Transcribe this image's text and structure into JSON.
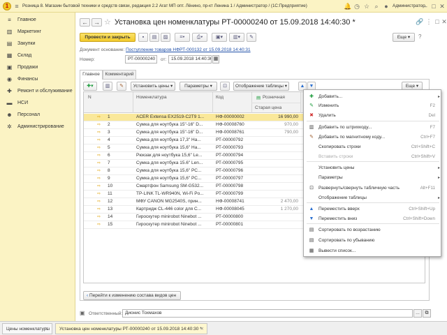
{
  "window": {
    "title": "Розница 8. Магазин бытовой техники и средств связи, редакция 2.2 Агат МП опт. Лёнино, пр-кт Ленина 1 / Администратор / (1С:Предприятие)",
    "user": "Администратор"
  },
  "sidebar": {
    "items": [
      {
        "label": "Главное",
        "icon": "menu-icon"
      },
      {
        "label": "Маркетинг",
        "icon": "chart-icon"
      },
      {
        "label": "Закупки",
        "icon": "basket-icon"
      },
      {
        "label": "Склад",
        "icon": "warehouse-icon"
      },
      {
        "label": "Продажи",
        "icon": "sales-icon"
      },
      {
        "label": "Финансы",
        "icon": "finance-icon"
      },
      {
        "label": "Ремонт и обслуживание",
        "icon": "repair-icon"
      },
      {
        "label": "НСИ",
        "icon": "book-icon"
      },
      {
        "label": "Персонал",
        "icon": "person-icon"
      },
      {
        "label": "Администрирование",
        "icon": "gear-icon"
      }
    ]
  },
  "document": {
    "title": "Установка цен номенклатуры РТ-00000240 от 15.09.2018 14:40:30 *",
    "post_close_label": "Провести и закрыть",
    "more_label": "Еще",
    "basis_label": "Документ основание:",
    "basis_link": "Поступление товаров НФРТ-000132 от 15.09.2018 14:40:31",
    "number_label": "Номер:",
    "number_value": "РТ-00000240",
    "date_label": "от:",
    "date_value": "15.09.2018 14:40:30",
    "tabs": [
      "Главное",
      "Комментарий"
    ]
  },
  "table_toolbar": {
    "set_prices": "Установить цены",
    "params": "Параметры",
    "display": "Отображение таблицы",
    "more": "Еще"
  },
  "table": {
    "headers": {
      "n": "N",
      "item": "Номенклатура",
      "code": "Код",
      "retail": "Розничная",
      "old_price": "Старая цена"
    },
    "rows": [
      {
        "n": "1",
        "item": "ACER Extensa EX2519-C2T9 1...",
        "code": "НФ-00000002",
        "price": "16 990,00",
        "old": ""
      },
      {
        "n": "2",
        "item": "Сумка для ноутбука 15\"-16\" D...",
        "code": "НФ-00008760",
        "price": "970,00",
        "old": ""
      },
      {
        "n": "3",
        "item": "Сумка для ноутбука 15\"-16\" D...",
        "code": "НФ-00008761",
        "price": "790,00",
        "old": ""
      },
      {
        "n": "4",
        "item": "Сумка для ноутбука 17,3\" На...",
        "code": "РТ-00000792",
        "price": "",
        "old": ""
      },
      {
        "n": "5",
        "item": "Сумка для ноутбука 15,6\" На...",
        "code": "РТ-00000793",
        "price": "",
        "old": ""
      },
      {
        "n": "6",
        "item": "Рюкзак для ноутбука 15,6\" Le...",
        "code": "РТ-00000794",
        "price": "",
        "old": ""
      },
      {
        "n": "7",
        "item": "Сумка для ноутбука 15.6\" Len...",
        "code": "РТ-00000795",
        "price": "",
        "old": ""
      },
      {
        "n": "8",
        "item": "Сумка для ноутбука 15,6\" РС...",
        "code": "РТ-00000796",
        "price": "",
        "old": ""
      },
      {
        "n": "9",
        "item": "Сумка для ноутбука 15,6\" РС...",
        "code": "РТ-00000797",
        "price": "",
        "old": ""
      },
      {
        "n": "10",
        "item": "Смартфон Samsung SM-G532...",
        "code": "РТ-00000798",
        "price": "",
        "old": ""
      },
      {
        "n": "11",
        "item": "TP-LINK TL-WR940N, Wi-Fi Po...",
        "code": "РТ-00000799",
        "price": "",
        "old": ""
      },
      {
        "n": "12",
        "item": "МФУ CANON MG2540S, прин...",
        "code": "НФ-00008741",
        "price": "2 470,00",
        "old": ""
      },
      {
        "n": "13",
        "item": "Картридж CL-446 color для C...",
        "code": "НФ-00008045",
        "price": "1 270,00",
        "old": ""
      },
      {
        "n": "14",
        "item": "Гироскутер minirobot Ninebot ...",
        "code": "РТ-00000800",
        "price": "",
        "old": ""
      },
      {
        "n": "15",
        "item": "Гироскутер minirobot Ninebot ...",
        "code": "РТ-00000801",
        "price": "",
        "old": ""
      }
    ]
  },
  "menu": {
    "items": [
      {
        "label": "Добавить...",
        "shortcut": "",
        "icon": "plus-icon",
        "sub": true,
        "disabled": false
      },
      {
        "label": "Изменить",
        "shortcut": "F2",
        "icon": "edit-icon",
        "sub": false,
        "disabled": false
      },
      {
        "label": "Удалить",
        "shortcut": "Del",
        "icon": "delete-icon",
        "sub": false,
        "disabled": false
      },
      {
        "label": "Добавить по штрихкоду...",
        "shortcut": "F7",
        "icon": "barcode-icon",
        "sub": false,
        "disabled": false
      },
      {
        "label": "Добавить по магнитному коду...",
        "shortcut": "Ctrl+F7",
        "icon": "magnet-card-icon",
        "sub": false,
        "disabled": false
      },
      {
        "label": "Скопировать строки",
        "shortcut": "Ctrl+Shift+C",
        "icon": "copy-icon",
        "sub": false,
        "disabled": false
      },
      {
        "label": "Вставить строки",
        "shortcut": "Ctrl+Shift+V",
        "icon": "paste-icon",
        "sub": false,
        "disabled": true
      },
      {
        "label": "Установить цены",
        "shortcut": "",
        "icon": "",
        "sub": true,
        "disabled": false
      },
      {
        "label": "Параметры",
        "shortcut": "",
        "icon": "",
        "sub": true,
        "disabled": false
      },
      {
        "label": "Развернуть/свернуть табличную часть",
        "shortcut": "Alt+F11",
        "icon": "expand-icon",
        "sub": false,
        "disabled": false
      },
      {
        "label": "Отображение таблицы",
        "shortcut": "",
        "icon": "",
        "sub": true,
        "disabled": false
      },
      {
        "label": "Переместить вверх",
        "shortcut": "Ctrl+Shift+Up",
        "icon": "arrow-up-icon",
        "sub": false,
        "disabled": false
      },
      {
        "label": "Переместить вниз",
        "shortcut": "Ctrl+Shift+Down",
        "icon": "arrow-down-icon",
        "sub": false,
        "disabled": false
      },
      {
        "label": "Сортировать по возрастанию",
        "shortcut": "",
        "icon": "sort-asc-icon",
        "sub": false,
        "disabled": false
      },
      {
        "label": "Сортировать по убыванию",
        "shortcut": "",
        "icon": "sort-desc-icon",
        "sub": false,
        "disabled": false
      },
      {
        "label": "Вывести список...",
        "shortcut": "",
        "icon": "list-icon",
        "sub": false,
        "disabled": false
      }
    ]
  },
  "footer": {
    "change_link": "Перейти к изменению состава видов цен",
    "responsible_label": "Ответственный:",
    "responsible_value": "Дионис Тохмахов"
  },
  "statusbar": {
    "tabs": [
      "Цены номенклатуры",
      "Установка цен номенклатуры РТ-00000240 от 15.09.2018 14:40:30 *"
    ]
  },
  "colors": {
    "selected_row": "#fae89a",
    "accent_yellow": "#f1c92c",
    "sidebar_bg": "#fbf3c4",
    "link": "#1f4fa8"
  }
}
